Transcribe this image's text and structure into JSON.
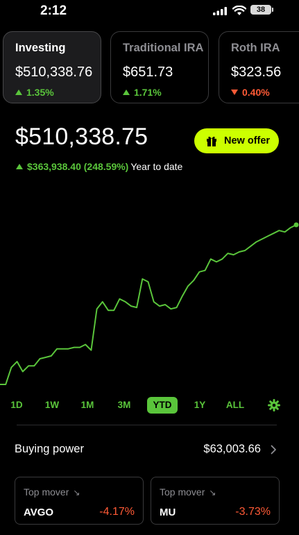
{
  "status": {
    "time": "2:12",
    "battery": "38"
  },
  "accounts": [
    {
      "name": "Investing",
      "value": "$510,338.76",
      "change": "1.35%",
      "direction": "up"
    },
    {
      "name": "Traditional IRA",
      "value": "$651.73",
      "change": "1.71%",
      "direction": "up"
    },
    {
      "name": "Roth IRA",
      "value": "$323.56",
      "change": "0.40%",
      "direction": "down"
    }
  ],
  "portfolio": {
    "total": "$510,338.75",
    "ytd_change": "$363,938.40 (248.59%)",
    "ytd_label": "Year to date"
  },
  "offer_button": {
    "label": "New offer",
    "icon": "gift-icon"
  },
  "chart_data": {
    "type": "line",
    "color": "#5ac53b",
    "values": [
      0.0,
      0.0,
      0.12,
      0.16,
      0.09,
      0.13,
      0.13,
      0.18,
      0.19,
      0.2,
      0.25,
      0.25,
      0.25,
      0.26,
      0.26,
      0.28,
      0.24,
      0.53,
      0.58,
      0.52,
      0.52,
      0.6,
      0.58,
      0.55,
      0.54,
      0.74,
      0.72,
      0.58,
      0.55,
      0.56,
      0.53,
      0.54,
      0.62,
      0.69,
      0.73,
      0.79,
      0.8,
      0.88,
      0.86,
      0.88,
      0.92,
      0.91,
      0.93,
      0.94,
      0.97,
      1.0,
      1.02,
      1.04,
      1.06,
      1.08,
      1.07,
      1.1,
      1.12
    ]
  },
  "ranges": {
    "options": [
      "1D",
      "1W",
      "1M",
      "3M",
      "YTD",
      "1Y",
      "ALL"
    ],
    "selected": "YTD"
  },
  "buying_power": {
    "label": "Buying power",
    "value": "$63,003.66"
  },
  "top_movers": [
    {
      "label": "Top mover",
      "symbol": "AVGO",
      "change": "-4.17%"
    },
    {
      "label": "Top mover",
      "symbol": "MU",
      "change": "-3.73%"
    }
  ],
  "icons": {
    "settings": "gear-icon",
    "chevron": "chevron-right-icon",
    "mover_arrow": "arrow-down-right-icon"
  }
}
